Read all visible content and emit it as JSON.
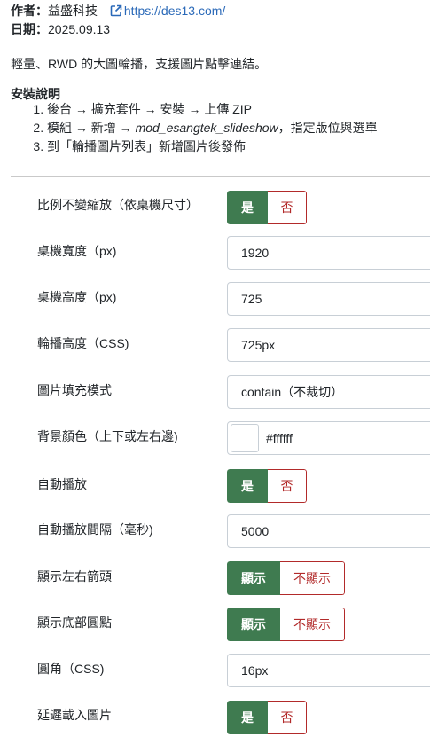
{
  "meta": {
    "author_label": "作者：",
    "author": "益盛科技",
    "link_text": "https://des13.com/",
    "date_label": "日期：",
    "date": "2025.09.13"
  },
  "description": "輕量、RWD 的大圖輪播，支援圖片點擊連結。",
  "install": {
    "title": "安裝說明",
    "steps": [
      "後台 → 擴充套件 → 安裝 → 上傳 ZIP",
      "模組 → 新增 → ",
      "到「輪播圖片列表」新增圖片後發佈"
    ],
    "step2_italic": "mod_esangtek_slideshow",
    "step2_tail": "，指定版位與選單"
  },
  "settings": {
    "keep_ratio": {
      "label": "比例不變縮放（依桌機尺寸）",
      "yes": "是",
      "no": "否",
      "selected": "yes"
    },
    "desktop_width": {
      "label": "桌機寬度（px)",
      "value": "1920"
    },
    "desktop_height": {
      "label": "桌機高度（px)",
      "value": "725"
    },
    "carousel_height": {
      "label": "輪播高度（CSS)",
      "value": "725px"
    },
    "fill_mode": {
      "label": "圖片填充模式",
      "value": "contain（不裁切）"
    },
    "bg_color": {
      "label": "背景顏色（上下或左右邊)",
      "value": "#ffffff"
    },
    "autoplay": {
      "label": "自動播放",
      "yes": "是",
      "no": "否",
      "selected": "yes"
    },
    "autoplay_interval": {
      "label": "自動播放間隔（毫秒)",
      "value": "5000"
    },
    "show_arrows": {
      "label": "顯示左右箭頭",
      "show": "顯示",
      "hide": "不顯示",
      "selected": "show"
    },
    "show_dots": {
      "label": "顯示底部圓點",
      "show": "顯示",
      "hide": "不顯示",
      "selected": "show"
    },
    "radius": {
      "label": "圓角（CSS)",
      "value": "16px"
    },
    "lazy_load": {
      "label": "延遲載入圖片",
      "yes": "是",
      "no": "否",
      "selected": "yes"
    }
  },
  "colors": {
    "on": "#3f7b50",
    "off_text": "#b22a2a",
    "link": "#2a69b8"
  }
}
